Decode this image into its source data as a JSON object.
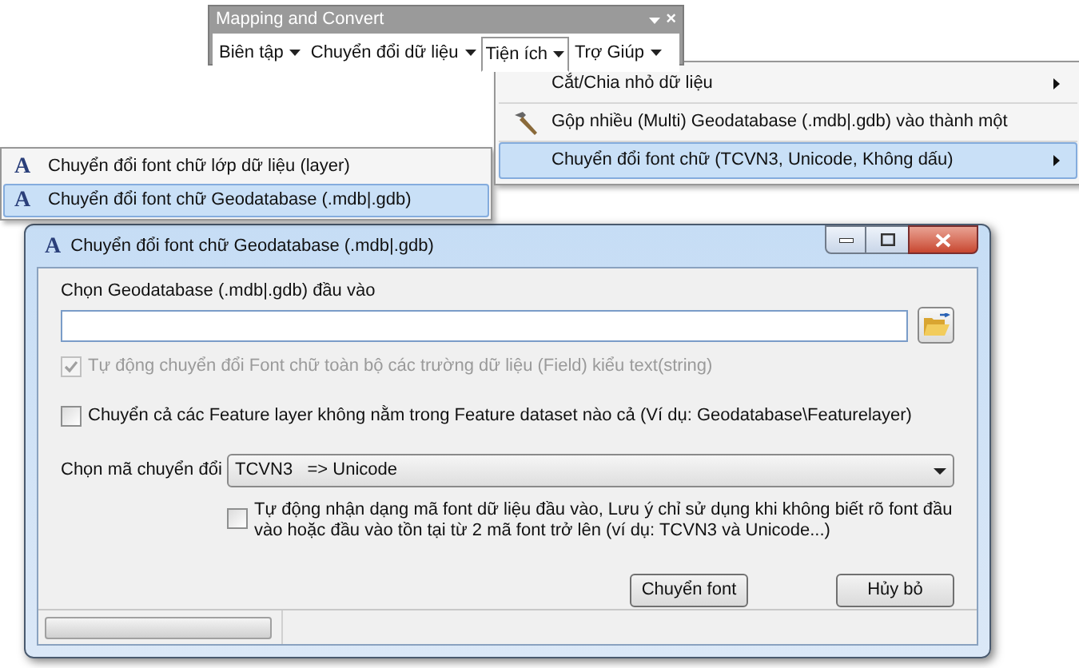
{
  "toolbar": {
    "title": "Mapping and Convert",
    "close_glyph": "×",
    "menus": [
      {
        "label": "Biên tập",
        "selected": false
      },
      {
        "label": "Chuyển đổi dữ liệu",
        "selected": false
      },
      {
        "label": "Tiện ích",
        "selected": true
      },
      {
        "label": "Trợ Giúp",
        "selected": false
      }
    ]
  },
  "submenu": {
    "items": [
      {
        "label": "Cắt/Chia nhỏ dữ liệu",
        "kind": "plain",
        "has_submenu": true,
        "selected": false
      },
      {
        "label": "Gộp nhiều (Multi) Geodatabase (.mdb|.gdb) vào thành một",
        "kind": "tool",
        "has_submenu": false,
        "selected": false
      },
      {
        "label": "Chuyển đổi font chữ (TCVN3, Unicode, Không dấu)",
        "kind": "plain",
        "has_submenu": true,
        "selected": true
      }
    ]
  },
  "font_submenu": {
    "items": [
      {
        "glyph": "A",
        "label": "Chuyển đổi font chữ lớp dữ liệu (layer)",
        "selected": false
      },
      {
        "glyph": "A",
        "label": "Chuyển đổi font chữ Geodatabase (.mdb|.gdb)",
        "selected": true
      }
    ]
  },
  "dialog": {
    "glyph": "A",
    "title": "Chuyển đổi font chữ Geodatabase (.mdb|.gdb)",
    "input_label": "Chọn Geodatabase (.mdb|.gdb) đầu vào",
    "checkbox_auto_fields": {
      "label": "Tự động chuyển đổi Font chữ toàn bộ các trường dữ liệu (Field) kiểu text(string)",
      "checked": true,
      "disabled": true
    },
    "checkbox_feature_layer": {
      "label": "Chuyển cả các Feature layer không nằm trong Feature dataset nào cả (Ví dụ: Geodatabase\\Featurelayer)",
      "checked": false,
      "disabled": false
    },
    "conversion_label": "Chọn mã chuyển đổi",
    "conversion_value": "TCVN3   => Unicode",
    "checkbox_auto_detect": {
      "label": "Tự động nhận dạng mã font dữ liệu đầu vào, Lưu ý chỉ sử dụng khi không biết rõ font đầu vào hoặc đầu vào tồn tại từ 2 mã font trở lên (ví dụ: TCVN3 và Unicode...)",
      "checked": false,
      "disabled": false
    },
    "buttons": [
      "Chuyển font",
      "Hủy bỏ"
    ],
    "progress": {
      "level": 0
    }
  }
}
